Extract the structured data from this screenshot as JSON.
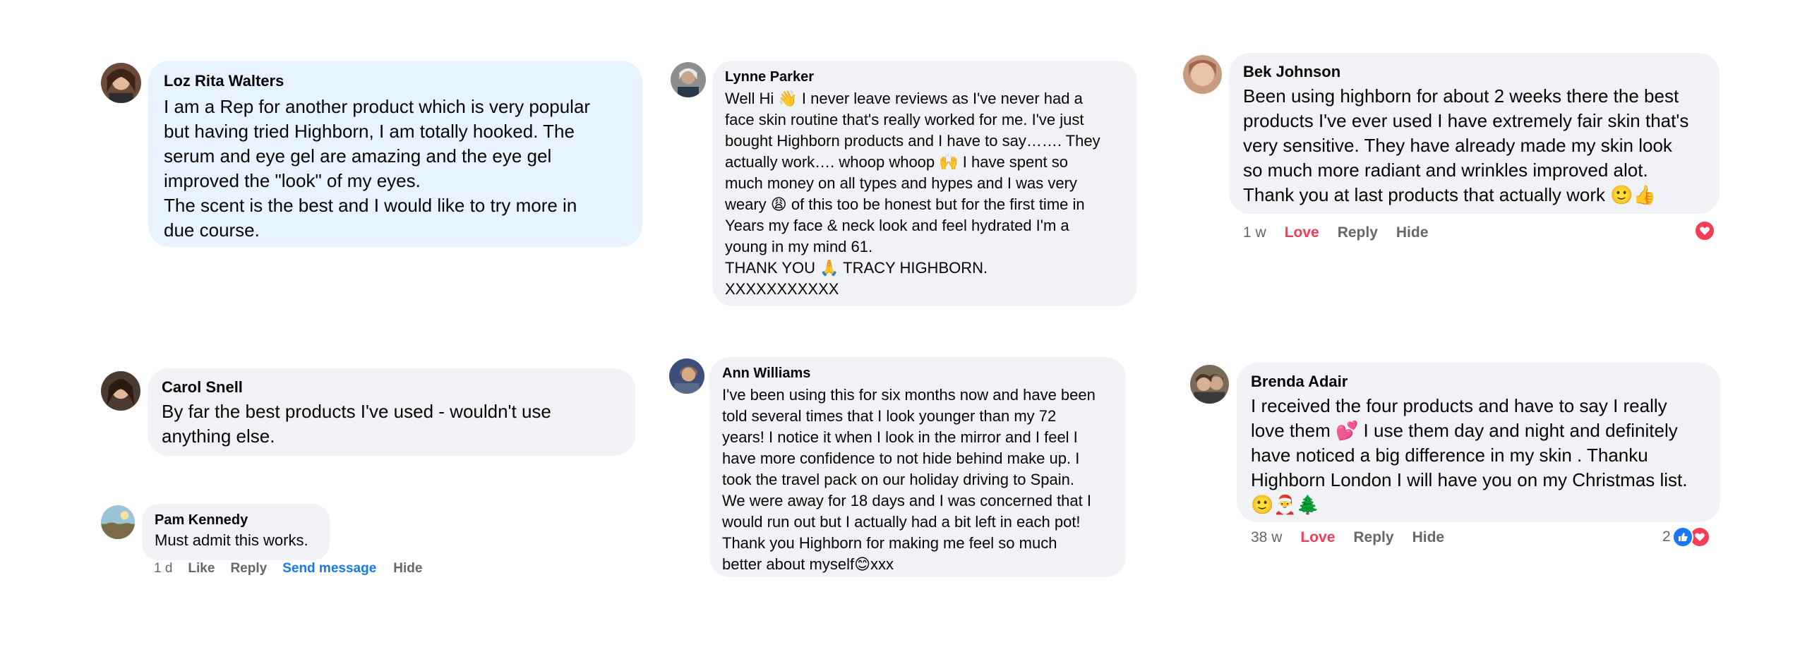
{
  "comments": [
    {
      "name": "Loz Rita Walters",
      "text": "I am a Rep for another product which is very popular\nbut having tried Highborn, I am totally hooked. The\nserum and eye gel are amazing and the eye gel\nimproved the \"look\" of my eyes.\nThe scent is the best and I would like to try more in\ndue course."
    },
    {
      "name": "Lynne Parker",
      "text": "Well Hi 👋 I never leave reviews as I've never had a\nface skin routine that's really worked for me. I've just\nbought Highborn products and I have to say……. They\nactually work…. whoop whoop 🙌 I have spent so\nmuch money on all types and hypes and I was very\nweary 😩 of this too be honest but for the first time in\nYears my face & neck look and feel hydrated I'm a\nyoung in my mind 61.\nTHANK YOU 🙏 TRACY HIGHBORN.\nXXXXXXXXXXX"
    },
    {
      "name": "Bek Johnson",
      "text": "Been using highborn for about 2 weeks there the best\nproducts I've ever used I have extremely fair skin that's\nvery sensitive. They have already made my skin look\nso much more radiant and wrinkles improved alot.\nThank you at last products that actually work 🙂👍",
      "actions": {
        "time": "1 w",
        "love": "Love",
        "reply": "Reply",
        "hide": "Hide"
      }
    },
    {
      "name": "Carol Snell",
      "text": "By far the best products I've used - wouldn't use\nanything else."
    },
    {
      "name": "Pam Kennedy",
      "text": "Must admit this works.",
      "actions": {
        "time": "1 d",
        "like": "Like",
        "reply": "Reply",
        "send": "Send message",
        "hide": "Hide"
      }
    },
    {
      "name": "Ann Williams",
      "text": "I've been using this for six months now and have been\ntold several times that I look younger than my 72\nyears! I notice it when I look in the mirror and I feel I\nhave more confidence to not hide behind make up. I\ntook the travel pack on our holiday driving to Spain.\nWe were away for 18 days and I was concerned that I\nwould run out but I actually had a bit left in each pot!\nThank you Highborn for making me feel so much\nbetter about myself😊xxx"
    },
    {
      "name": "Brenda Adair",
      "text": "I received the four products and have to say I really\nlove them 💕 I use them day and night and definitely\nhave noticed a big difference in my skin . Thanku\nHighborn London I will have you on my Christmas list.\n🙂🎅🌲",
      "actions": {
        "time": "38 w",
        "love": "Love",
        "reply": "Reply",
        "hide": "Hide"
      },
      "reaction_count": "2"
    }
  ],
  "colors": {
    "like_blue": "#1877f2",
    "love_red": "#f33e58"
  }
}
